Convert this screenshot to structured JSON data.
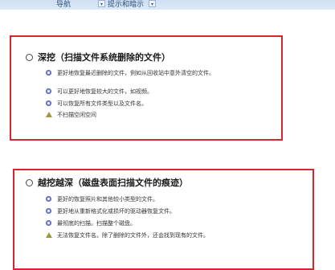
{
  "header": {
    "tabs": [
      {
        "label": "导航"
      },
      {
        "label": "提示和暗示"
      }
    ]
  },
  "options": [
    {
      "title": "深挖（扫描文件系统删除的文件）",
      "features": [
        {
          "type": "good",
          "text": "更好地恢复最近删除的文件，例如从回收站中意外清空的文件。"
        },
        {
          "type": "good",
          "text": "可以更好地恢复较大的文件，如视频。"
        },
        {
          "type": "good",
          "text": "可以恢复所有文件类型以及文件名。"
        },
        {
          "type": "warning",
          "text": "不扫描空闲空间"
        }
      ]
    },
    {
      "title": "越挖越深（磁盘表面扫描文件的痕迹）",
      "features": [
        {
          "type": "good",
          "text": "更好的恢复照片和其他较小类型的文件。"
        },
        {
          "type": "good",
          "text": "更好地从重新格式化或损坏的驱动器恢复文件。"
        },
        {
          "type": "good",
          "text": "最彻底的扫描。扫描整个磁盘。"
        },
        {
          "type": "warning",
          "text": "无法恢复文件名。除了删除的文件外，还会找到现有的文件。"
        }
      ]
    }
  ],
  "colors": {
    "highlight_border": "#d9262e",
    "good_icon": "#7f8fd2",
    "warning_icon": "#9b9a3b"
  },
  "icons": {
    "good": "check-bullet-icon",
    "warning": "warning-triangle-icon"
  }
}
